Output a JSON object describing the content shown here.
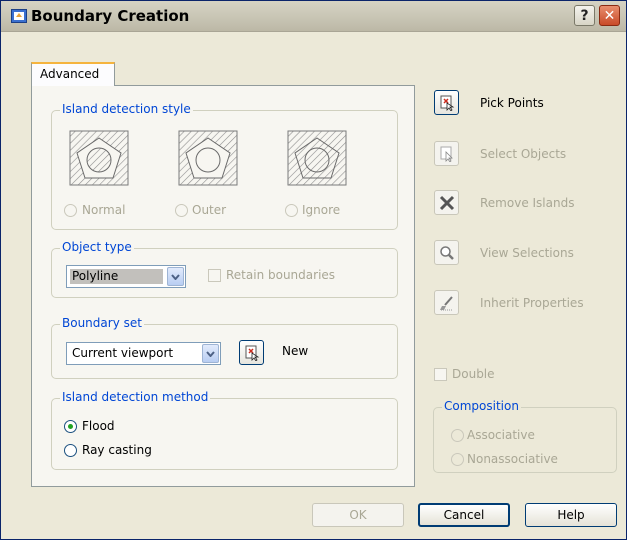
{
  "window": {
    "title": "Boundary Creation",
    "help_glyph": "?",
    "close_glyph": "✕"
  },
  "tabs": [
    {
      "label": "Advanced"
    }
  ],
  "island_detection_style": {
    "legend": "Island detection style",
    "options": [
      {
        "label": "Normal",
        "selected": false,
        "enabled": false
      },
      {
        "label": "Outer",
        "selected": false,
        "enabled": false
      },
      {
        "label": "Ignore",
        "selected": false,
        "enabled": false
      }
    ]
  },
  "object_type": {
    "legend": "Object type",
    "selected": "Polyline",
    "retain_boundaries_label": "Retain boundaries",
    "retain_boundaries_checked": false
  },
  "boundary_set": {
    "legend": "Boundary set",
    "selected": "Current viewport",
    "new_label": "New"
  },
  "island_detection_method": {
    "legend": "Island detection method",
    "options": [
      {
        "label": "Flood",
        "selected": true
      },
      {
        "label": "Ray casting",
        "selected": false
      }
    ]
  },
  "actions": {
    "pick_points": "Pick Points",
    "select_objects": "Select Objects",
    "remove_islands": "Remove Islands",
    "view_selections": "View Selections",
    "inherit_properties": "Inherit Properties"
  },
  "double": {
    "label": "Double",
    "checked": false
  },
  "composition": {
    "legend": "Composition",
    "associative": "Associative",
    "nonassociative": "Nonassociative"
  },
  "buttons": {
    "ok": "OK",
    "cancel": "Cancel",
    "help": "Help"
  },
  "colors": {
    "dialog_bg": "#ece9d8",
    "panel_bg": "#f7f6f1",
    "group_title": "#0046d5",
    "disabled_text": "#a9a795",
    "radio_dot": "#21a121",
    "button_border": "#003c74"
  },
  "icons": {
    "app": "app-icon",
    "pick_points": "pick-points-icon",
    "select_objects": "select-objects-icon",
    "remove_islands": "x-icon",
    "view_selections": "magnifier-icon",
    "inherit_properties": "brush-icon",
    "new_boundary_set": "pick-icon"
  }
}
